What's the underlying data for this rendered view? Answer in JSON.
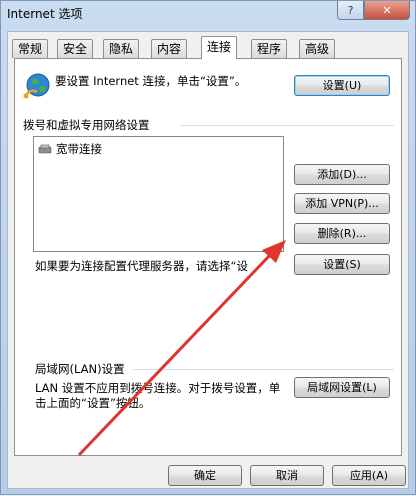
{
  "window": {
    "title": "Internet 选项",
    "help_label": "?",
    "close_label": "✕"
  },
  "tabs": [
    "常规",
    "安全",
    "隐私",
    "内容",
    "连接",
    "程序",
    "高级"
  ],
  "connections": {
    "setup_text": "要设置 Internet 连接，单击“设置”。",
    "setup_button": "设置(U)",
    "dialup_group_label": "拨号和虚拟专用网络设置",
    "dialup_items": [
      "宽带连接"
    ],
    "add_button": "添加(D)...",
    "add_vpn_button": "添加 VPN(P)...",
    "remove_button": "删除(R)...",
    "proxy_text": "如果要为连接配置代理服务器，请选择“设",
    "proxy_settings_button": "设置(S)",
    "lan_group_label": "局域网(LAN)设置",
    "lan_text": "LAN 设置不应用到拨号连接。对于拨号设置，单击上面的“设置”按钮。",
    "lan_settings_button": "局域网设置(L)"
  },
  "footer": {
    "ok_button": "确定",
    "cancel_button": "取消",
    "apply_button": "应用(A)"
  },
  "colors": {
    "annotation_arrow": "#e0342c",
    "title_gradient_top": "#c9dcf0"
  }
}
